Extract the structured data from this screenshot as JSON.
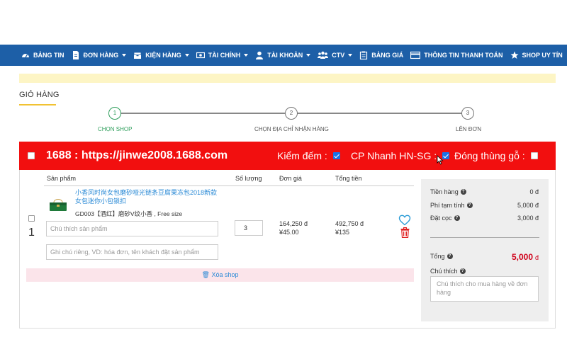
{
  "nav": {
    "items": [
      {
        "label": "BẢNG TIN",
        "icon": "dashboard-icon",
        "caret": false
      },
      {
        "label": "ĐƠN HÀNG",
        "icon": "document-icon",
        "caret": true
      },
      {
        "label": "KIỆN HÀNG",
        "icon": "package-icon",
        "caret": true
      },
      {
        "label": "TÀI CHÍNH",
        "icon": "money-icon",
        "caret": true
      },
      {
        "label": "TÀI KHOẢN",
        "icon": "user-icon",
        "caret": true
      },
      {
        "label": "CTV",
        "icon": "users-icon",
        "caret": true
      },
      {
        "label": "BẢNG GIÁ",
        "icon": "clipboard-icon",
        "caret": false
      },
      {
        "label": "THÔNG TIN THANH TOÁN",
        "icon": "credit-card-icon",
        "caret": false
      },
      {
        "label": "SHOP UY TÍN",
        "icon": "star-icon",
        "caret": false
      }
    ],
    "bg_color": "#1d5fa7"
  },
  "cart": {
    "title": "GIỎ HÀNG"
  },
  "steps": [
    {
      "number": "1",
      "label": "CHỌN SHOP",
      "active": true
    },
    {
      "number": "2",
      "label": "CHỌN ĐỊA CHỈ NHẬN HÀNG",
      "active": false
    },
    {
      "number": "3",
      "label": "LÊN ĐƠN",
      "active": false
    }
  ],
  "shop": {
    "name": "1688 : https://jinwe2008.1688.com",
    "kiem_dem_label": "Kiểm đếm :",
    "cp_nhanh_label": "CP Nhanh HN-SG :",
    "dong_thung_label": "Đóng thùng gỗ :",
    "bar_color": "#f20f0f"
  },
  "table": {
    "headers": {
      "product": "Sản phẩm",
      "qty": "Số lượng",
      "unit_price": "Đơn giá",
      "total": "Tổng tiền"
    }
  },
  "item": {
    "index": "1",
    "title": "小香风时尚女包磨砂哑光链条豆腐果冻包2018新款女包迷你小包锁扣",
    "sku": "GD003【酒红】磨砂V纹小香 , Free size",
    "note_placeholder": "Chú thích sản phẩm",
    "private_note_placeholder": "Ghi chú riêng, VD: hóa đơn, tên khách đặt sản phẩm",
    "quantity": "3",
    "unit_price_vnd": "164,250 đ",
    "unit_price_cny": "¥45.00",
    "total_vnd": "492,750 đ",
    "total_cny": "¥135"
  },
  "xoa_shop": "Xóa shop",
  "summary": {
    "tien_hang_label": "Tiền hàng",
    "tien_hang_value": "0 đ",
    "phi_tam_tinh_label": "Phí tạm tính",
    "phi_tam_tinh_value": "5,000 đ",
    "dat_coc_label": "Đặt cọc",
    "dat_coc_value": "3,000 đ",
    "tong_label": "Tổng",
    "tong_value": "5,000",
    "tong_unit": "đ",
    "chu_thich_label": "Chú thích",
    "note_placeholder": "Chú thích cho mua hàng về đơn hàng"
  }
}
